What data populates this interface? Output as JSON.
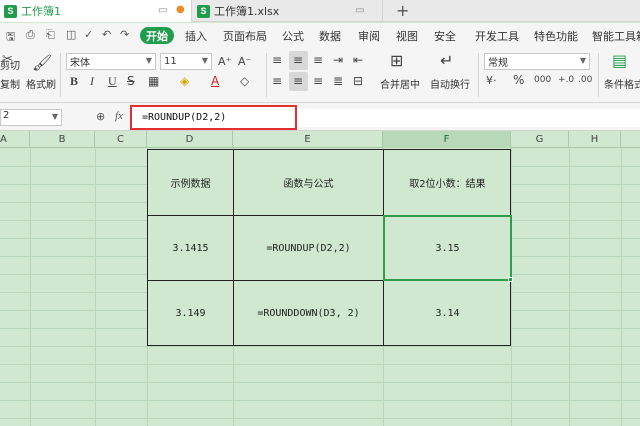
{
  "tabs": [
    {
      "label": "工作簿1",
      "active": true
    },
    {
      "label": "工作簿1.xlsx",
      "active": false
    }
  ],
  "menu": {
    "start": "开始",
    "items": [
      "插入",
      "页面布局",
      "公式",
      "数据",
      "审阅",
      "视图",
      "安全",
      "开发工具",
      "特色功能",
      "智能工具箱"
    ]
  },
  "ribbon": {
    "cut": "剪切",
    "copy": "复制",
    "format_painter": "格式刷",
    "font_name": "宋体",
    "font_size": "11",
    "bold": "B",
    "italic": "I",
    "underline": "U",
    "merge_center": "合并居中",
    "wrap_text": "自动换行",
    "number_format": "常规",
    "percent": "%",
    "conditional_format": "条件格式"
  },
  "formula_bar": {
    "name_box": "2",
    "fx": "fx",
    "formula": "=ROUNDUP(D2,2)"
  },
  "columns": [
    "A",
    "B",
    "C",
    "D",
    "E",
    "F",
    "G",
    "H"
  ],
  "selected_column": "F",
  "table": {
    "headers": [
      "示例数据",
      "函数与公式",
      "取2位小数：结果"
    ],
    "rows": [
      [
        "3.1415",
        "=ROUNDUP(D2,2)",
        "3.15"
      ],
      [
        "3.149",
        "=ROUNDDOWN(D3, 2)",
        "3.14"
      ]
    ]
  },
  "colors": {
    "accent": "#1f9d4d",
    "sheet_bg": "#cfe8cf",
    "highlight_border": "#e03030"
  }
}
